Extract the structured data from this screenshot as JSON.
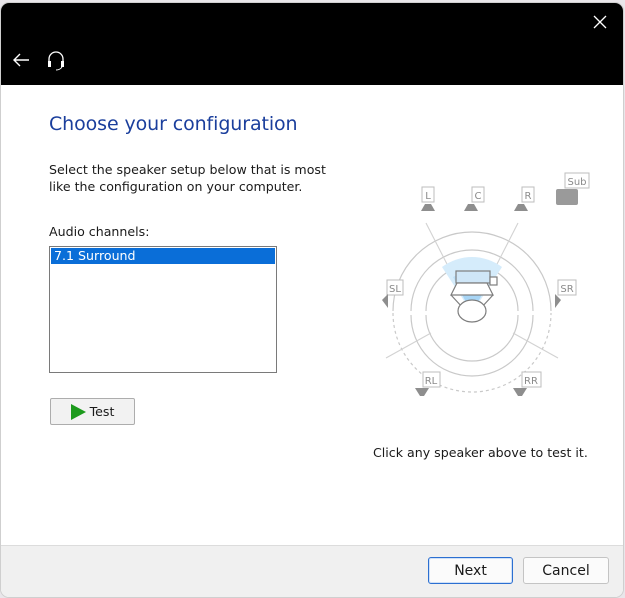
{
  "window": {
    "heading": "Choose your configuration",
    "intro": "Select the speaker setup below that is most like the configuration on your computer.",
    "channels_label": "Audio channels:",
    "channels": [
      {
        "label": "7.1 Surround",
        "selected": true
      }
    ],
    "test_label": "Test",
    "hint": "Click any speaker above to test it."
  },
  "speakers": {
    "L": "L",
    "C": "C",
    "R": "R",
    "Sub": "Sub",
    "SL": "SL",
    "SR": "SR",
    "RL": "RL",
    "RR": "RR"
  },
  "footer": {
    "next_label": "Next",
    "cancel_label": "Cancel"
  },
  "icons": {
    "close": "close-icon",
    "back": "back-arrow-icon",
    "app": "headset-icon",
    "play": "play-icon"
  },
  "colors": {
    "heading": "#1a3e9c",
    "selection": "#0a6ed8",
    "play": "#1c9a1c",
    "titlebar": "#000000"
  }
}
